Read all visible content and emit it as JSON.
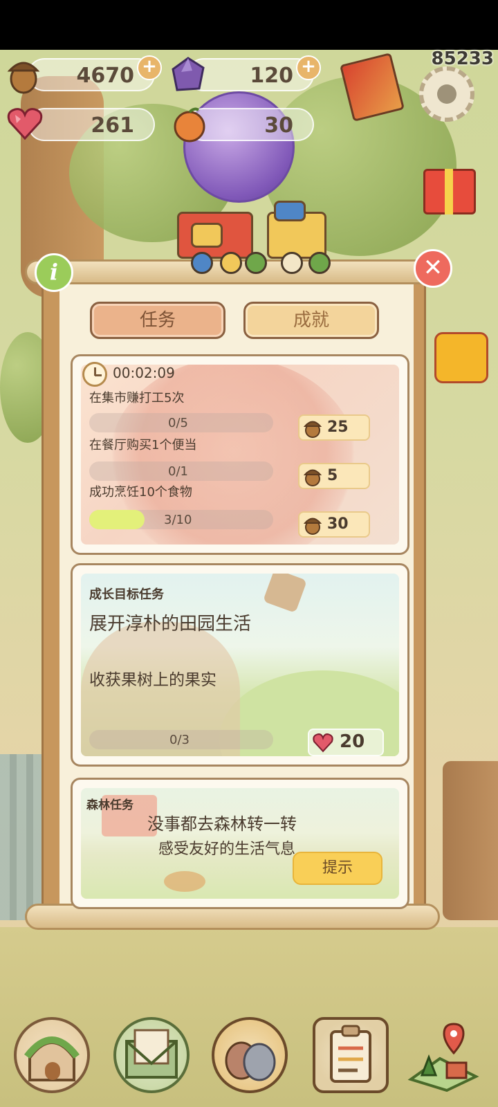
{
  "resources": {
    "acorn": {
      "value": "4670",
      "icon": "acorn-icon"
    },
    "gem": {
      "value": "120",
      "icon": "purple-gem-icon"
    },
    "heart": {
      "value": "261",
      "icon": "heart-gem-icon"
    },
    "orange": {
      "value": "30",
      "icon": "orange-fruit-icon"
    }
  },
  "top_counter": "85233",
  "tabs": {
    "tasks": "任务",
    "achievements": "成就"
  },
  "daily_card": {
    "timer": "00:02:09",
    "tasks": [
      {
        "label": "在集市赚打工5次",
        "progress_text": "0/5",
        "progress": 0.0,
        "reward": "25"
      },
      {
        "label": "在餐厅购买1个便当",
        "progress_text": "0/1",
        "progress": 0.0,
        "reward": "5"
      },
      {
        "label": "成功烹饪10个食物",
        "progress_text": "3/10",
        "progress": 0.3,
        "reward": "30"
      }
    ]
  },
  "growth_card": {
    "category": "成长目标任务",
    "title": "展开淳朴的田园生活",
    "task": "收获果树上的果实",
    "progress_text": "0/3",
    "progress": 0.0,
    "reward": "20"
  },
  "forest_card": {
    "category": "森林任务",
    "line1": "没事都去森林转一转",
    "line2": "感受友好的生活气息",
    "hint_button": "提示"
  },
  "colors": {
    "tab_active": "#ebb38b",
    "tab_inactive": "#f3d49b",
    "progress_fill": "#e3f07a",
    "hint_button": "#f9cf57",
    "close_button": "#ee6a5e",
    "info_button": "#9bcc5a"
  },
  "nav": [
    "home-icon",
    "mail-letter-icon",
    "birds-icon",
    "clipboard-icon",
    "map-icon"
  ]
}
